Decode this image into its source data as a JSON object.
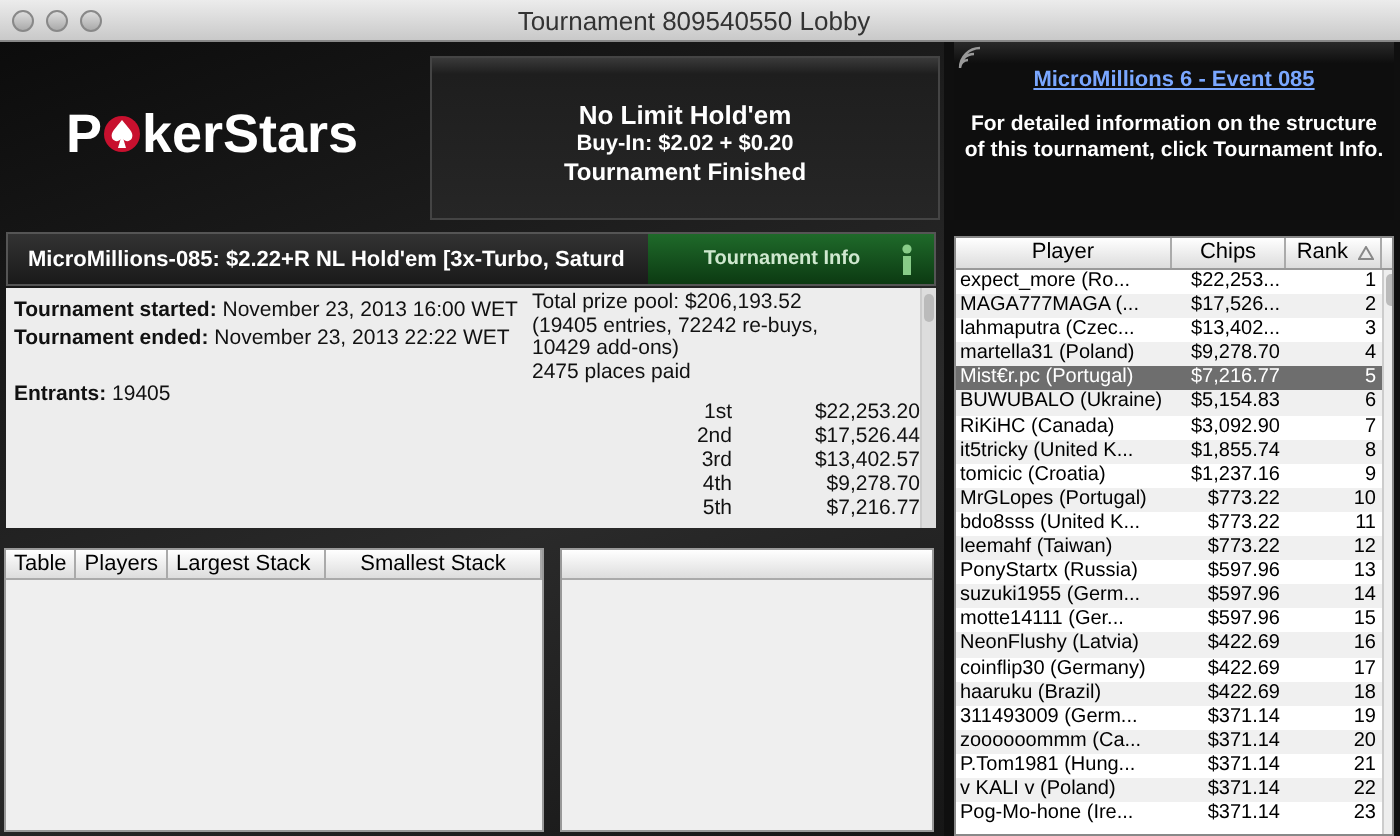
{
  "window": {
    "title": "Tournament 809540550 Lobby"
  },
  "logo": {
    "before": "P",
    "after": "kerStars"
  },
  "game": {
    "type": "No Limit Hold'em",
    "buy_in": "Buy-In: $2.02 + $0.20",
    "status": "Tournament Finished"
  },
  "promo": {
    "link": "MicroMillions 6 - Event 085",
    "text": "For detailed information on the structure of this tournament, click Tournament Info."
  },
  "tournament": {
    "title": "MicroMillions-085: $2.22+R NL Hold'em [3x-Turbo, Saturd",
    "info_button": "Tournament Info",
    "started_label": "Tournament started:",
    "started": "November 23, 2013 16:00 WET",
    "ended_label": "Tournament ended:",
    "ended": "November 23, 2013 22:22 WET",
    "entrants_label": "Entrants:",
    "entrants": "19405",
    "prize_pool": "Total prize pool: $206,193.52",
    "prize_detail": "(19405 entries, 72242 re-buys, 10429 add-ons)",
    "places_paid": "2475 places paid",
    "payouts": [
      {
        "place": "1st",
        "amount": "$22,253.20"
      },
      {
        "place": "2nd",
        "amount": "$17,526.44"
      },
      {
        "place": "3rd",
        "amount": "$13,402.57"
      },
      {
        "place": "4th",
        "amount": "$9,278.70"
      },
      {
        "place": "5th",
        "amount": "$7,216.77"
      }
    ]
  },
  "tables": {
    "columns": [
      "Table",
      "Players",
      "Largest Stack",
      "Smallest Stack"
    ]
  },
  "players": {
    "columns": [
      "Player",
      "Chips",
      "Rank"
    ],
    "rows": [
      {
        "player": "expect_more (Ro...",
        "chips": "$22,253...",
        "rank": "1",
        "selected": false
      },
      {
        "player": "MAGA777MAGA (...",
        "chips": "$17,526...",
        "rank": "2",
        "selected": false
      },
      {
        "player": "lahmaputra (Czec...",
        "chips": "$13,402...",
        "rank": "3",
        "selected": false
      },
      {
        "player": "martella31 (Poland)",
        "chips": "$9,278.70",
        "rank": "4",
        "selected": false
      },
      {
        "player": "Mist€r.pc (Portugal)",
        "chips": "$7,216.77",
        "rank": "5",
        "selected": true
      },
      {
        "player": "BUWUBALO (Ukraine)",
        "chips": "$5,154.83",
        "rank": "6",
        "selected": false
      },
      {
        "player": "RiKiHC (Canada)",
        "chips": "$3,092.90",
        "rank": "7",
        "selected": false
      },
      {
        "player": "it5tricky (United K...",
        "chips": "$1,855.74",
        "rank": "8",
        "selected": false
      },
      {
        "player": "tomicic (Croatia)",
        "chips": "$1,237.16",
        "rank": "9",
        "selected": false
      },
      {
        "player": "MrGLopes (Portugal)",
        "chips": "$773.22",
        "rank": "10",
        "selected": false
      },
      {
        "player": "bdo8sss (United K...",
        "chips": "$773.22",
        "rank": "11",
        "selected": false
      },
      {
        "player": "leemahf (Taiwan)",
        "chips": "$773.22",
        "rank": "12",
        "selected": false
      },
      {
        "player": "PonyStartx (Russia)",
        "chips": "$597.96",
        "rank": "13",
        "selected": false
      },
      {
        "player": "suzuki1955 (Germ...",
        "chips": "$597.96",
        "rank": "14",
        "selected": false
      },
      {
        "player": "motte14111 (Ger...",
        "chips": "$597.96",
        "rank": "15",
        "selected": false
      },
      {
        "player": "NeonFlushy (Latvia)",
        "chips": "$422.69",
        "rank": "16",
        "selected": false
      },
      {
        "player": "coinflip30 (Germany)",
        "chips": "$422.69",
        "rank": "17",
        "selected": false
      },
      {
        "player": "haaruku (Brazil)",
        "chips": "$422.69",
        "rank": "18",
        "selected": false
      },
      {
        "player": "311493009 (Germ...",
        "chips": "$371.14",
        "rank": "19",
        "selected": false
      },
      {
        "player": "zoooooommm (Ca...",
        "chips": "$371.14",
        "rank": "20",
        "selected": false
      },
      {
        "player": "P.Tom1981 (Hung...",
        "chips": "$371.14",
        "rank": "21",
        "selected": false
      },
      {
        "player": "v KALI v (Poland)",
        "chips": "$371.14",
        "rank": "22",
        "selected": false
      },
      {
        "player": "Pog-Mo-hone (Ire...",
        "chips": "$371.14",
        "rank": "23",
        "selected": false
      }
    ]
  }
}
